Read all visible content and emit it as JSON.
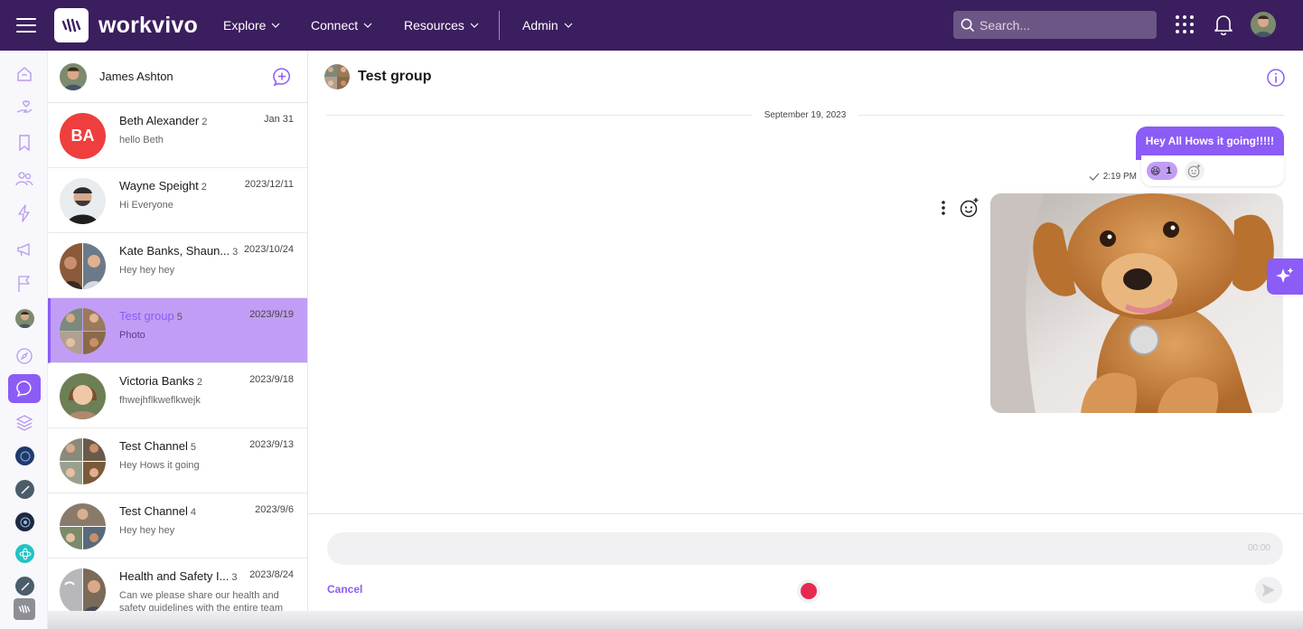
{
  "topbar": {
    "brand": "workvivo",
    "nav": [
      {
        "label": "Explore"
      },
      {
        "label": "Connect"
      },
      {
        "label": "Resources"
      },
      {
        "label": "Admin"
      }
    ],
    "search_placeholder": "Search..."
  },
  "colors": {
    "topbar_bg": "#3b1e5e",
    "accent": "#8b5cf6",
    "active_conversation": "#c29df5",
    "record": "#e5294f"
  },
  "left_rail": {
    "icons": [
      "home-icon",
      "hand-heart-icon",
      "bookmark-icon",
      "people-icon",
      "bolt-icon",
      "megaphone-icon",
      "flag-icon",
      "user-avatar",
      "compass-icon",
      "chat-icon",
      "layers-icon",
      "space-avatar-1",
      "space-avatar-2",
      "space-avatar-3",
      "space-avatar-4",
      "space-avatar-5",
      "workvivo-logo"
    ],
    "active": "chat-icon"
  },
  "conversation_list": {
    "current_user": "James Ashton",
    "items": [
      {
        "name": "Beth Alexander",
        "count": "2",
        "date": "Jan 31",
        "preview": "hello Beth",
        "initials": "BA"
      },
      {
        "name": "Wayne Speight",
        "count": "2",
        "date": "2023/12/11",
        "preview": "Hi Everyone"
      },
      {
        "name": "Kate Banks, Shaun...",
        "count": "3",
        "date": "2023/10/24",
        "preview": "Hey hey hey"
      },
      {
        "name": "Test group",
        "count": "5",
        "date": "2023/9/19",
        "preview": "Photo",
        "active": true
      },
      {
        "name": "Victoria Banks",
        "count": "2",
        "date": "2023/9/18",
        "preview": "fhwejhflkweflkwejk"
      },
      {
        "name": "Test Channel",
        "count": "5",
        "date": "2023/9/13",
        "preview": "Hey Hows it going"
      },
      {
        "name": "Test Channel",
        "count": "4",
        "date": "2023/9/6",
        "preview": "Hey hey hey"
      },
      {
        "name": "Health and Safety I...",
        "count": "3",
        "date": "2023/8/24",
        "preview": "Can we please share our health and safety guidelines with the entire team"
      }
    ]
  },
  "chat": {
    "title": "Test group",
    "date_separator": "September 19, 2023",
    "messages": [
      {
        "text": "Hey All Hows it going!!!!!",
        "time": "2:19 PM",
        "reaction_emoji": "😆",
        "reaction_count": "1"
      },
      {
        "type": "photo",
        "subject": "puppy"
      }
    ],
    "composer": {
      "recording_time": "00:00",
      "cancel_label": "Cancel"
    }
  }
}
